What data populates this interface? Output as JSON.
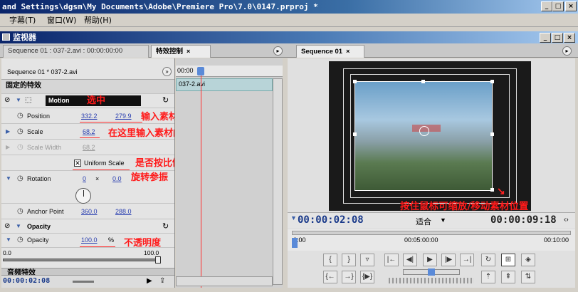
{
  "window": {
    "title": "and Settings\\dgsm\\My Documents\\Adobe\\Premiere Pro\\7.0\\0147.prproj *",
    "min": "_",
    "max": "□",
    "close": "×"
  },
  "menu": [
    "字幕(T)",
    "窗口(W)",
    "帮助(H)"
  ],
  "monitor_panel": {
    "title": "监视器"
  },
  "tabs": {
    "source": "Sequence 01 : 037-2.avi : 00:00:00:00",
    "effects": "特效控制",
    "program": "Sequence 01"
  },
  "effect_controls": {
    "clip_path": "Sequence 01 * 037-2.avi",
    "clip_name": "037-2.avi",
    "ruler_start": "00:00",
    "fixed_effects": "固定的特效",
    "motion": "Motion",
    "position_label": "Position",
    "position_x": "332.2",
    "position_y": "279.9",
    "scale_label": "Scale",
    "scale_value": "68.2",
    "scale_width_label": "Scale Width",
    "scale_width_value": "68.2",
    "uniform_scale": "Uniform Scale",
    "rotation_label": "Rotation",
    "rotation_turns": "0",
    "rotation_x": "×",
    "rotation_deg": "0.0",
    "anchor_label": "Anchor Point",
    "anchor_x": "360.0",
    "anchor_y": "288.0",
    "opacity_group": "Opacity",
    "opacity_label": "Opacity",
    "opacity_value": "100.0",
    "opacity_unit": "%",
    "slider_min": "0.0",
    "slider_max": "100.0",
    "bottom_timecode": "00:00:02:08",
    "next_group": "音频特效"
  },
  "annotations": {
    "select": "选中",
    "position": "输入素材位置",
    "scale": "在这里输入素材的%数据",
    "uniform": "是否按比例缩放素材",
    "rotation": "旋转参振",
    "opacity": "不透明度",
    "drag": "按住鼠标可缩放/移动素材位置"
  },
  "program": {
    "current_tc": "00:00:02:08",
    "fit": "适合",
    "duration_tc": "00:00:09:18",
    "ruler_labels": [
      "0:00",
      "00:05:00:00",
      "00:10:00"
    ]
  },
  "colors": {
    "annotation": "#ff1a1a",
    "timecode": "#1a3a8a",
    "playhead": "#ff3030"
  }
}
